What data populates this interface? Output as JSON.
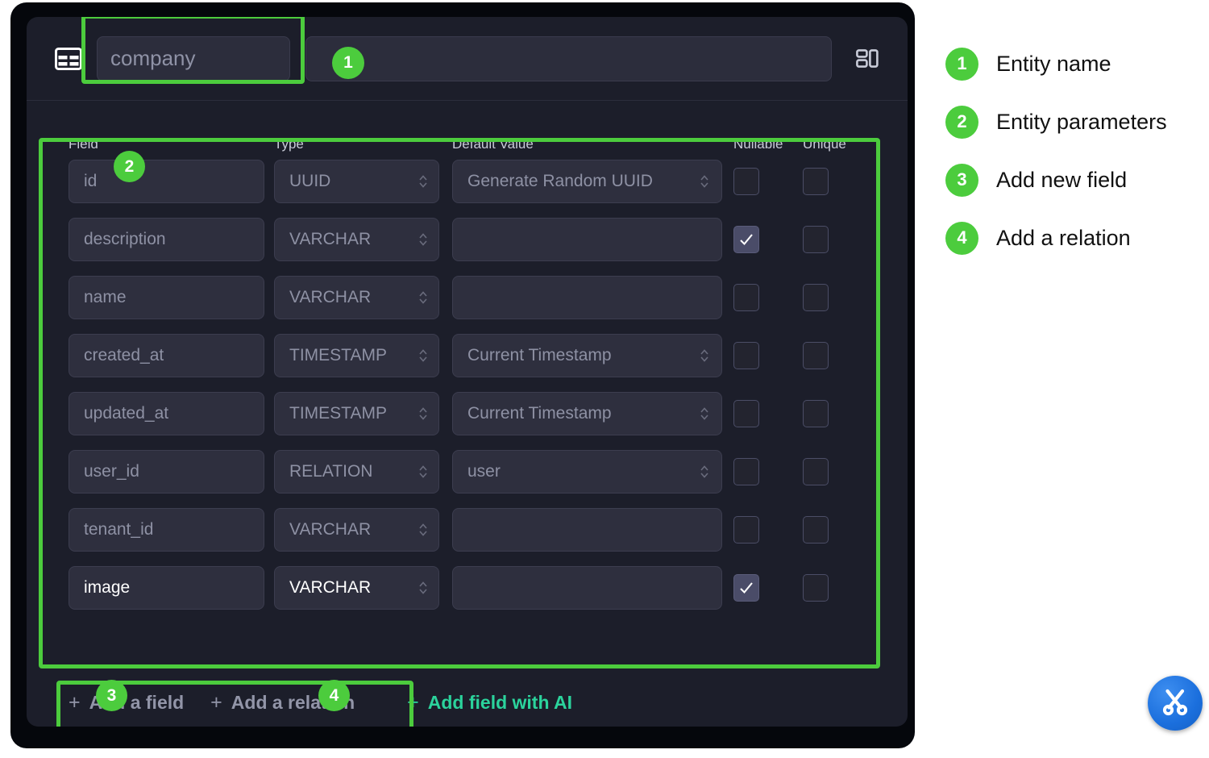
{
  "window": {
    "table_icon": "table-icon",
    "layout_icon": "layout-grid-icon"
  },
  "entity": {
    "name_value": "company",
    "name_placeholder": "Entity name"
  },
  "fields_table": {
    "columns": [
      "Field",
      "Type",
      "Default Value",
      "Nullable",
      "Unique"
    ],
    "rows": [
      {
        "field": "id",
        "type": "UUID",
        "default": "Generate Random UUID",
        "has_default_select": true,
        "nullable": false,
        "unique": false,
        "active": false
      },
      {
        "field": "description",
        "type": "VARCHAR",
        "default": "",
        "has_default_select": false,
        "nullable": true,
        "unique": false,
        "active": false
      },
      {
        "field": "name",
        "type": "VARCHAR",
        "default": "",
        "has_default_select": false,
        "nullable": false,
        "unique": false,
        "active": false
      },
      {
        "field": "created_at",
        "type": "TIMESTAMP",
        "default": "Current Timestamp",
        "has_default_select": true,
        "nullable": false,
        "unique": false,
        "active": false
      },
      {
        "field": "updated_at",
        "type": "TIMESTAMP",
        "default": "Current Timestamp",
        "has_default_select": true,
        "nullable": false,
        "unique": false,
        "active": false
      },
      {
        "field": "user_id",
        "type": "RELATION",
        "default": "user",
        "has_default_select": true,
        "nullable": false,
        "unique": false,
        "active": false
      },
      {
        "field": "tenant_id",
        "type": "VARCHAR",
        "default": "",
        "has_default_select": false,
        "nullable": false,
        "unique": false,
        "active": false
      },
      {
        "field": "image",
        "type": "VARCHAR",
        "default": "",
        "has_default_select": false,
        "nullable": true,
        "unique": false,
        "active": true
      }
    ]
  },
  "actions": {
    "add_field": "Add a field",
    "add_relation": "Add a relation",
    "add_field_ai": "Add field with AI",
    "plus": "+",
    "ai_color": "#2bd39c"
  },
  "annotations": {
    "badges": [
      "1",
      "2",
      "3",
      "4"
    ],
    "accent_color": "#4ccc3d"
  },
  "legend": {
    "items": [
      {
        "num": "1",
        "label": "Entity name"
      },
      {
        "num": "2",
        "label": "Entity parameters"
      },
      {
        "num": "3",
        "label": "Add new field"
      },
      {
        "num": "4",
        "label": "Add a relation"
      }
    ]
  },
  "floating": {
    "snip_icon": "scissors-icon"
  },
  "theme": {
    "page_bg": "#ffffff",
    "frame_bg": "#05070c",
    "panel_bg": "#1c1e2a",
    "input_bg": "#2e2f3e",
    "input_border": "#3c3d4f",
    "text_muted": "#8e91a4",
    "text_active": "#ffffff",
    "checkbox_checked_bg": "#4a4c68"
  }
}
